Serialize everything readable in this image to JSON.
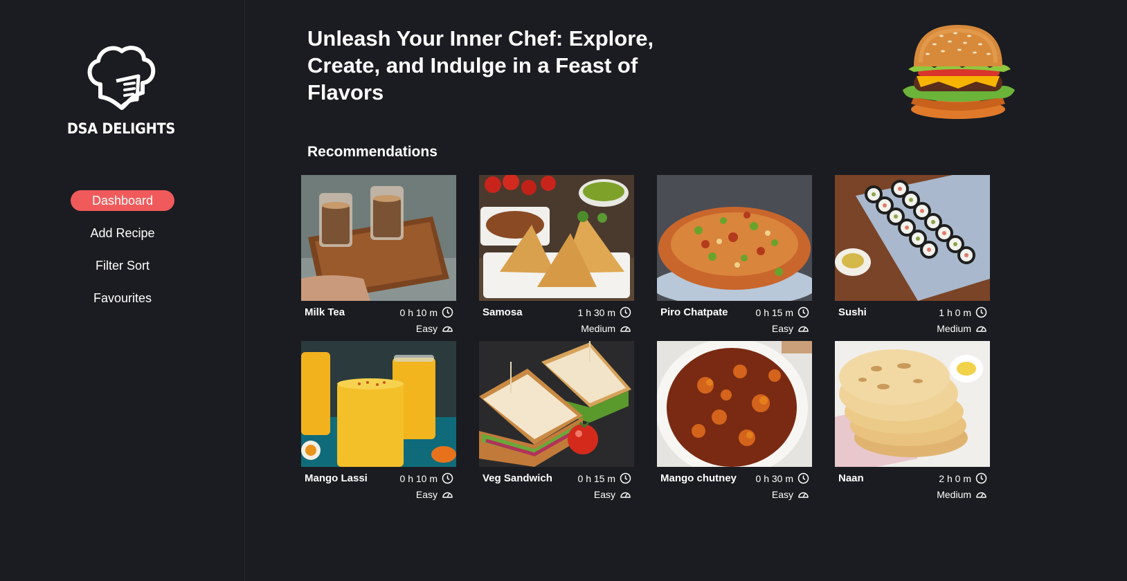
{
  "brand": {
    "name": "DSA DELIGHTS",
    "logo_icon": "chef-hat-icon"
  },
  "sidebar": {
    "items": [
      {
        "label": "Dashboard",
        "active": true
      },
      {
        "label": "Add Recipe",
        "active": false
      },
      {
        "label": "Filter Sort",
        "active": false
      },
      {
        "label": "Favourites",
        "active": false
      }
    ]
  },
  "hero": {
    "title": "Unleash Your Inner Chef: Explore, Create, and Indulge in a Feast of Flavors",
    "image": "burger-image"
  },
  "recommendations": {
    "title": "Recommendations",
    "recipes": [
      {
        "name": "Milk Tea",
        "time": "0 h 10 m",
        "difficulty": "Easy",
        "image": "milk-tea-image"
      },
      {
        "name": "Samosa",
        "time": "1 h 30 m",
        "difficulty": "Medium",
        "image": "samosa-image"
      },
      {
        "name": "Piro Chatpate",
        "time": "0 h 15 m",
        "difficulty": "Easy",
        "image": "piro-chatpate-image"
      },
      {
        "name": "Sushi",
        "time": "1 h 0 m",
        "difficulty": "Medium",
        "image": "sushi-image"
      },
      {
        "name": "Mango Lassi",
        "time": "0 h 10 m",
        "difficulty": "Easy",
        "image": "mango-lassi-image"
      },
      {
        "name": "Veg Sandwich",
        "time": "0 h 15 m",
        "difficulty": "Easy",
        "image": "veg-sandwich-image"
      },
      {
        "name": "Mango chutney",
        "time": "0 h 30 m",
        "difficulty": "Easy",
        "image": "mango-chutney-image"
      },
      {
        "name": "Naan",
        "time": "2 h 0 m",
        "difficulty": "Medium",
        "image": "naan-image"
      }
    ]
  },
  "colors": {
    "background": "#1b1c21",
    "accent": "#f05a5b",
    "text": "#ffffff"
  }
}
